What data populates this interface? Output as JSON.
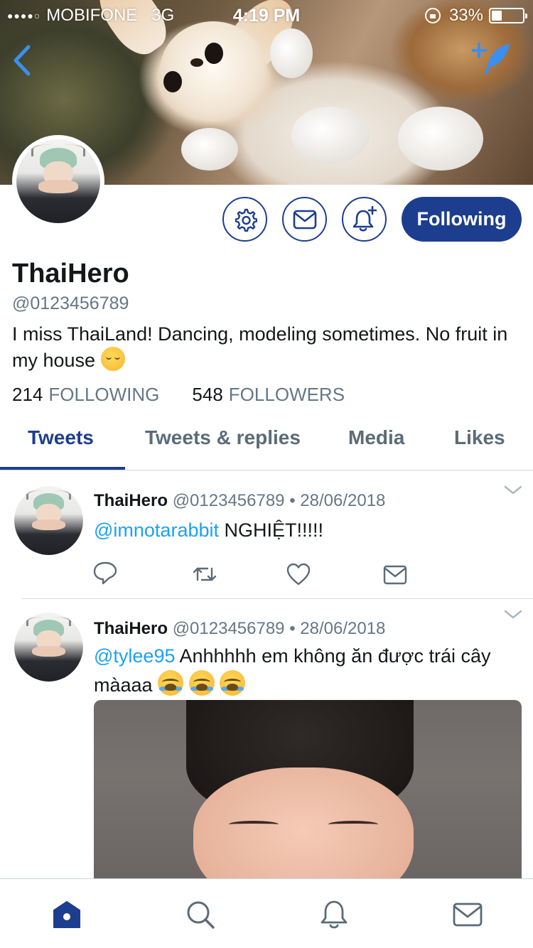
{
  "status_bar": {
    "carrier": "MOBIFONE",
    "network": "3G",
    "time": "4:19 PM",
    "battery": "33%",
    "battery_level": 0.33
  },
  "profile": {
    "name": "ThaiHero",
    "handle": "@0123456789",
    "bio": "I miss ThaiLand! Dancing, modeling sometimes. No fruit in my house",
    "following_count": "214",
    "following_label": "FOLLOWING",
    "followers_count": "548",
    "followers_label": "FOLLOWERS",
    "follow_button": "Following"
  },
  "tabs": [
    "Tweets",
    "Tweets & replies",
    "Media",
    "Likes"
  ],
  "tweets": [
    {
      "name": "ThaiHero",
      "meta": "@0123456789 • 28/06/2018",
      "mention": "@imnotarabbit",
      "text": " NGHIỆT!!!!!"
    },
    {
      "name": "ThaiHero",
      "meta": "@0123456789 • 28/06/2018",
      "mention": "@tylee95",
      "text": " Anhhhhh em không ăn được trái cây màaaa"
    }
  ],
  "colors": {
    "accent": "#1d3e8e",
    "mention": "#1da1f2",
    "secondary_text": "#657786"
  },
  "icons": {
    "back": "chevron-left-icon",
    "compose": "feather-plus-icon",
    "settings": "gear-icon",
    "message": "envelope-icon",
    "notify": "bell-plus-icon",
    "reply": "reply-icon",
    "retweet": "retweet-icon",
    "like": "heart-icon",
    "dm": "envelope-icon",
    "nav_home": "home-icon",
    "nav_search": "search-icon",
    "nav_notifications": "bell-icon",
    "nav_messages": "envelope-icon"
  }
}
